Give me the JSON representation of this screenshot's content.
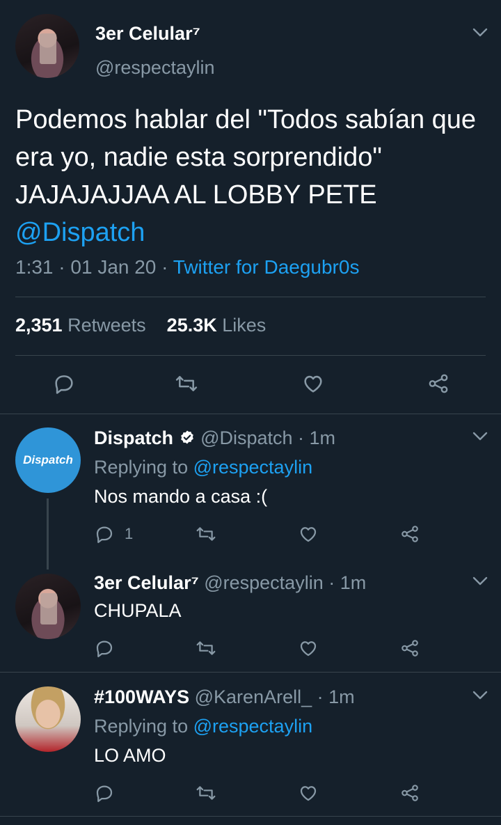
{
  "main_tweet": {
    "display_name": "3er Celular⁷",
    "handle": "@respectaylin",
    "text_plain": "Podemos hablar del \"Todos sabían que era yo, nadie esta sorprendido\" JAJAJAJJAA AL LOBBY PETE",
    "text_mention": "@Dispatch",
    "time": "1:31",
    "date": "01 Jan 20",
    "source": "Twitter for Daegubr0s",
    "retweets_count": "2,351",
    "retweets_label": "Retweets",
    "likes_count": "25.3K",
    "likes_label": "Likes"
  },
  "replies": [
    {
      "display_name": "Dispatch",
      "verified": true,
      "handle": "@Dispatch",
      "age": "1m",
      "replying_prefix": "Replying to",
      "replying_to": "@respectaylin",
      "text": "Nos mando a casa :(",
      "reply_count": "1",
      "avatar_text": "Dispatch"
    },
    {
      "display_name": "3er Celular⁷",
      "handle": "@respectaylin",
      "age": "1m",
      "text": "CHUPALA"
    },
    {
      "display_name": "#100WAYS",
      "handle": "@KarenArell_",
      "age": "1m",
      "replying_prefix": "Replying to",
      "replying_to": "@respectaylin",
      "text": "LO AMO"
    }
  ],
  "sep": " · ",
  "colors": {
    "background": "#15202b",
    "text": "#ffffff",
    "muted": "#8899a6",
    "link": "#1da1f2",
    "divider": "#38444d"
  },
  "icons": [
    "chevron-down-icon",
    "reply-icon",
    "retweet-icon",
    "like-icon",
    "share-icon",
    "verified-icon"
  ]
}
